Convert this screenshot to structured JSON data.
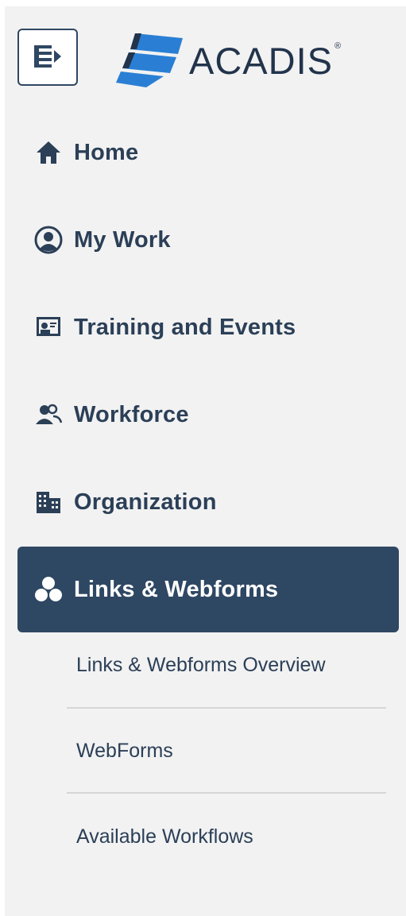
{
  "brand": {
    "name": "ACADIS",
    "registered": "®"
  },
  "colors": {
    "active_bg": "#2e4763",
    "text": "#2b3f57",
    "sidebar_bg": "#f2f2f2",
    "logo_blue": "#2a7fd4"
  },
  "nav": {
    "items": [
      {
        "label": "Home",
        "icon": "home-icon"
      },
      {
        "label": "My Work",
        "icon": "user-circle-icon"
      },
      {
        "label": "Training and Events",
        "icon": "presentation-icon"
      },
      {
        "label": "Workforce",
        "icon": "users-icon"
      },
      {
        "label": "Organization",
        "icon": "building-icon"
      },
      {
        "label": "Links & Webforms",
        "icon": "cubes-icon",
        "active": true
      }
    ],
    "sub_items": [
      {
        "label": "Links & Webforms Overview"
      },
      {
        "label": "WebForms"
      },
      {
        "label": "Available Workflows"
      }
    ]
  }
}
